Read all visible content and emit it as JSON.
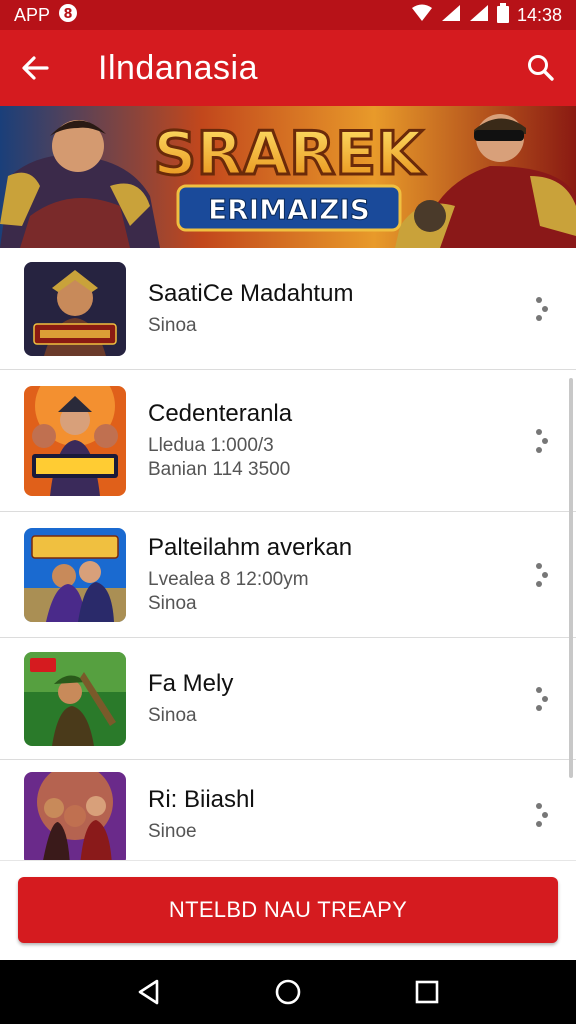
{
  "status": {
    "app_label": "APP",
    "time": "14:38"
  },
  "header": {
    "title": "Ilndanasia"
  },
  "banner": {
    "title_line1": "SRAREK",
    "title_line2": "ERIMAIZIS"
  },
  "list": [
    {
      "name": "SaatiCe Madahtum",
      "lines": [
        "Sinoa"
      ]
    },
    {
      "name": "Cedenteranla",
      "lines": [
        "Lledua 1:000/3",
        "Banian 114 3500"
      ]
    },
    {
      "name": "Palteilahm averkan",
      "lines": [
        "Lvealea 8 12:00ym",
        "Sinoa"
      ]
    },
    {
      "name": "Fa Mely",
      "lines": [
        "Sinoa"
      ]
    },
    {
      "name": "Ri: Biiashl",
      "lines": [
        "Sinoe"
      ]
    }
  ],
  "cta": {
    "label": "NTELBD NAU TREAPY"
  },
  "colors": {
    "primary": "#d51b1f",
    "status": "#b71218"
  }
}
